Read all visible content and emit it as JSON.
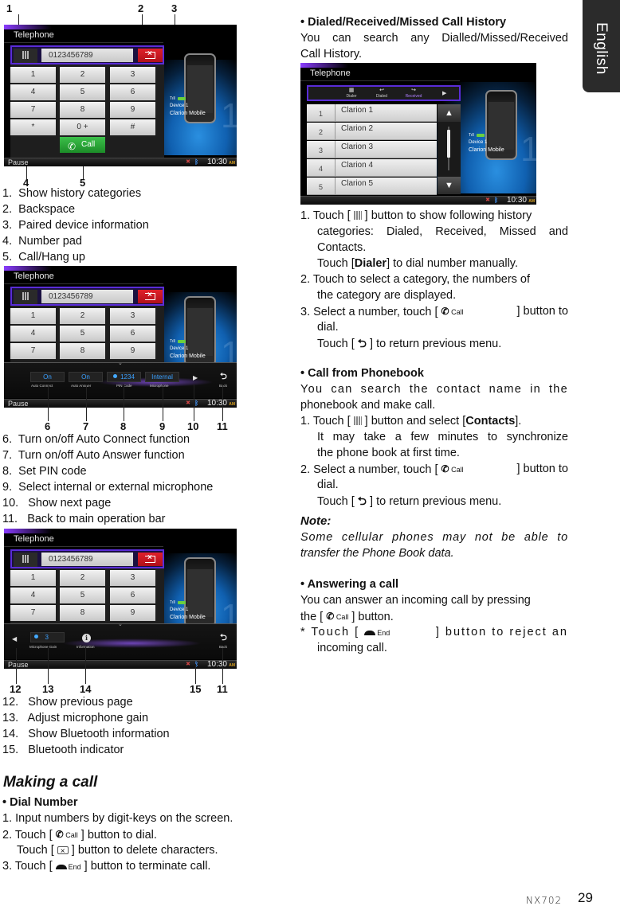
{
  "side_tab": "English",
  "footer": {
    "model": "NX702",
    "page": "29"
  },
  "screen_common": {
    "title": "Telephone",
    "number_field": "0123456789",
    "keys": [
      "1",
      "2",
      "3",
      "4",
      "5",
      "6",
      "7",
      "8",
      "9",
      "*",
      "0 +",
      "#"
    ],
    "call_label": "Call",
    "device_signal": "Tıll",
    "device_name": "Device 1",
    "device_model": "Clarion Mobile",
    "big_number": "1",
    "status_left": "Pause",
    "status_time": "10:30",
    "status_ampm": "AM"
  },
  "screen1": {
    "callouts": [
      "1",
      "2",
      "3",
      "4",
      "5"
    ]
  },
  "list1": [
    {
      "n": "1.",
      "text": "Show history categories"
    },
    {
      "n": "2.",
      "text": "Backspace"
    },
    {
      "n": "3.",
      "text": "Paired device information"
    },
    {
      "n": "4.",
      "text": "Number pad"
    },
    {
      "n": "5.",
      "text": "Call/Hang up"
    }
  ],
  "screen2": {
    "callouts": [
      "6",
      "7",
      "8",
      "9",
      "10",
      "11"
    ],
    "op_items": [
      {
        "value": "On",
        "label": "Auto Connect"
      },
      {
        "value": "On",
        "label": "Auto Answer"
      },
      {
        "value": "1234",
        "label": "PIN Code"
      },
      {
        "value": "Internal",
        "label": "Microphone"
      }
    ],
    "back_label": "Back"
  },
  "list2": [
    {
      "n": "6.",
      "text": "Turn on/off Auto Connect function"
    },
    {
      "n": "7.",
      "text": "Turn on/off Auto Answer function"
    },
    {
      "n": "8.",
      "text": "Set PIN code"
    },
    {
      "n": "9.",
      "text": "Select internal or external microphone"
    },
    {
      "n": "10.",
      "text": "Show next page"
    },
    {
      "n": "11.",
      "text": "Back to main operation bar"
    }
  ],
  "screen3": {
    "callouts": [
      "12",
      "13",
      "14",
      "15",
      "11"
    ],
    "mic_gain_value": "3",
    "mic_gain_label": "Microphone Gain",
    "info_label": "Information",
    "back_label": "Back"
  },
  "list3": [
    {
      "n": "12.",
      "text": "Show previous page"
    },
    {
      "n": "13.",
      "text": "Adjust microphone gain"
    },
    {
      "n": "14.",
      "text": "Show Bluetooth information"
    },
    {
      "n": "15.",
      "text": "Bluetooth indicator"
    }
  ],
  "making_call": {
    "heading": "Making a call",
    "dial_heading": "• Dial Number",
    "step1": "1.  Input numbers by digit-keys on the screen.",
    "step2_pre": "2.   Touch [ ",
    "step2_post": " ] button to dial.",
    "step2b_pre": "Touch [ ",
    "step2b_post": " ] button to delete characters.",
    "step3_pre": "3.  Touch [ ",
    "step3_post": " ] button to terminate call.",
    "end_label": "End"
  },
  "history": {
    "heading": "• Dialed/Received/Missed Call History",
    "intro_line1": "You can search any Dialled/Missed/Received",
    "intro_line2": "Call History.",
    "tabs": [
      {
        "label": "Dialer",
        "glyph": "▦"
      },
      {
        "label": "Dialed",
        "glyph": "↩"
      },
      {
        "label": "Received",
        "glyph": "↪"
      }
    ],
    "rows": [
      {
        "n": "1",
        "name": "Clarion 1"
      },
      {
        "n": "2",
        "name": "Clarion 2"
      },
      {
        "n": "3",
        "name": "Clarion 3"
      },
      {
        "n": "4",
        "name": "Clarion 4"
      },
      {
        "n": "5",
        "name": "Clarion 5"
      }
    ],
    "s1_pre": "1.  Touch [ ",
    "s1_post": " ] button to show following history",
    "s1_l2": "categories: Dialed, Received, Missed and",
    "s1_l3": "Contacts.",
    "s1_l4_pre": "Touch [",
    "s1_l4_bold": "Dialer",
    "s1_l4_post": "] to dial number manually.",
    "s2_l1": "2.  Touch to select a category, the numbers of",
    "s2_l2": "the category are displayed.",
    "s3_pre": "3.  Select a number, touch [ ",
    "s3_post": " ] button to",
    "s3_l2": "dial.",
    "s3_l3_pre": "Touch [ ",
    "s3_l3_post": " ] to return previous menu."
  },
  "phonebook": {
    "heading": "• Call from Phonebook",
    "intro_line1": "You can search the contact name in the",
    "intro_line2": "phonebook and make call.",
    "s1_pre": "1.  Touch [ ",
    "s1_mid": " ] button and select [",
    "s1_bold": "Contacts",
    "s1_post": "].",
    "s1_l2": "It may take a few minutes to synchronize",
    "s1_l3": "the phone book at first time.",
    "s2_pre": "2.  Select a number, touch [ ",
    "s2_post": " ] button to",
    "s2_l2": "dial.",
    "s2_l3_pre": "Touch [ ",
    "s2_l3_post": " ] to return previous menu."
  },
  "note": {
    "heading": "Note:",
    "line1": "Some cellular phones may not be able to",
    "line2": "transfer the Phone Book data."
  },
  "answering": {
    "heading": "• Answering a call",
    "line1": "You can answer an incoming call by pressing",
    "line2_pre": "the [ ",
    "line2_post": " ] button.",
    "reject_pre": "*  Touch [ ",
    "reject_post": " ]  button to reject an",
    "reject_l2": "incoming call."
  }
}
